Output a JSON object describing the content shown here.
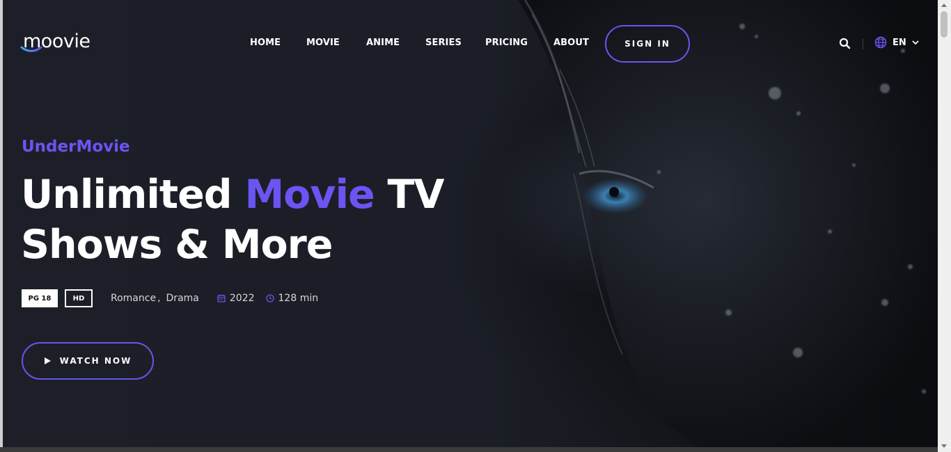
{
  "brand": {
    "logo_text": "moovie",
    "accent_color": "#6a55f2"
  },
  "nav": {
    "items": [
      "HOME",
      "MOVIE",
      "ANIME",
      "SERIES",
      "PRICING",
      "ABOUT"
    ],
    "signin_label": "SIGN IN",
    "search_icon": "search-icon",
    "language": {
      "icon": "globe-icon",
      "label": "EN"
    }
  },
  "hero": {
    "kicker": "UnderMovie",
    "title_part1": "Unlimited ",
    "title_accent": "Movie",
    "title_part2": " TV",
    "title_line2": "Shows & More",
    "rating_badge": "PG 18",
    "quality_badge": "HD",
    "genres": [
      "Romance",
      "Drama"
    ],
    "genre_separator": ",",
    "year": "2022",
    "duration": "128 min",
    "watch_label": "WATCH NOW"
  }
}
